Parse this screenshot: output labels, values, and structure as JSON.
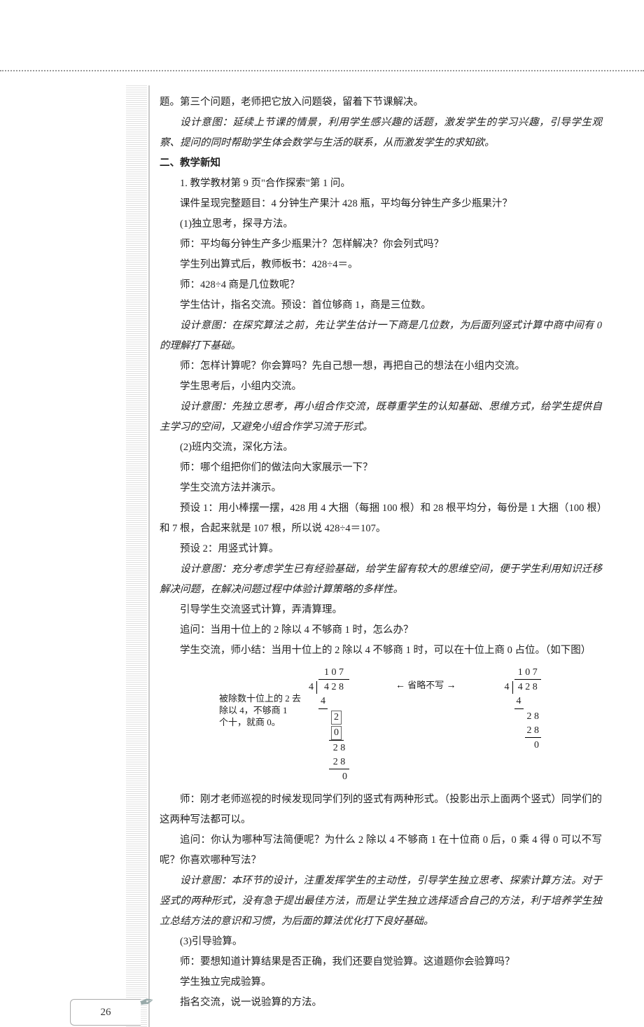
{
  "page_number": "26",
  "paragraphs": {
    "p01": "题。第三个问题，老师把它放入问题袋，留着下节课解决。",
    "p02": "设计意图：延续上节课的情景，利用学生感兴趣的话题，激发学生的学习兴趣，引导学生观察、提问的同时帮助学生体会数学与生活的联系，从而激发学生的求知欲。",
    "h2": "二、教学新知",
    "p03": "1. 教学教材第 9 页\"合作探索\"第 1 问。",
    "p04": "课件呈现完整题目：4 分钟生产果汁 428 瓶，平均每分钟生产多少瓶果汁？",
    "p05": "(1)独立思考，探寻方法。",
    "p06": "师：平均每分钟生产多少瓶果汁？怎样解决？你会列式吗？",
    "p07": "学生列出算式后，教师板书：428÷4＝。",
    "p08": "师：428÷4 商是几位数呢？",
    "p09": "学生估计，指名交流。预设：首位够商 1，商是三位数。",
    "p10": "设计意图：在探究算法之前，先让学生估计一下商是几位数，为后面列竖式计算中商中间有 0 的理解打下基础。",
    "p11": "师：怎样计算呢？你会算吗？先自己想一想，再把自己的想法在小组内交流。",
    "p12": "学生思考后，小组内交流。",
    "p13": "设计意图：先独立思考，再小组合作交流，既尊重学生的认知基础、思维方式，给学生提供自主学习的空间，又避免小组合作学习流于形式。",
    "p14": "(2)班内交流，深化方法。",
    "p15": "师：哪个组把你们的做法向大家展示一下？",
    "p16": "学生交流方法并演示。",
    "p17": "预设 1：用小棒摆一摆，428 用 4 大捆（每捆 100 根）和 28 根平均分，每份是 1 大捆（100 根）和 7 根，合起来就是 107 根，所以说 428÷4＝107。",
    "p18": "预设 2：用竖式计算。",
    "p19": "设计意图：充分考虑学生已有经验基础，给学生留有较大的思维空间，便于学生利用知识迁移解决问题，在解决问题过程中体验计算策略的多样性。",
    "p20": "引导学生交流竖式计算，弄清算理。",
    "p21": "追问：当用十位上的 2 除以 4 不够商 1 时，怎么办？",
    "p22": "学生交流，师小结：当用十位上的 2 除以 4 不够商 1 时，可以在十位上商 0 占位。（如下图）",
    "p23": "师：刚才老师巡视的时候发现同学们列的竖式有两种形式。（投影出示上面两个竖式）同学们的这两种写法都可以。",
    "p24": "追问：你认为哪种写法简便呢？为什么 2 除以 4 不够商 1 在十位商 0 后，0 乘 4 得 0 可以不写呢？你喜欢哪种写法？",
    "p25": "设计意图：本环节的设计，注重发挥学生的主动性，引导学生独立思考、探索计算方法。对于竖式的两种形式，没有急于提出最佳方法，而是让学生独立选择适合自己的方法，利于培养学生独立总结方法的意识和习惯，为后面的算法优化打下良好基础。",
    "p26": "(3)引导验算。",
    "p27": "师：要想知道计算结果是否正确，我们还要自觉验算。这道题你会验算吗？",
    "p28": "学生独立完成验算。",
    "p29": "指名交流，说一说验算的方法。"
  },
  "figure": {
    "quotient": "1 0 7",
    "divisor": "4",
    "dividend": "4 2 8",
    "step_a1": "4",
    "step_a2_box1": "2",
    "step_a2_box2": "0",
    "step_a3": "2 8",
    "step_a4": "2 8",
    "step_a5": "0",
    "bracket_note_l1": "被除数十位上的 2 去",
    "bracket_note_l2": "除以 4，不够商 1",
    "bracket_note_l3": "个十，就商 0。",
    "mid_label": "省略不写",
    "b_quotient": "1 0 7",
    "b_divisor": "4",
    "b_dividend": "4 2 8",
    "b_step1": "4",
    "b_step2": "2 8",
    "b_step3": "2 8",
    "b_step4": "0"
  }
}
